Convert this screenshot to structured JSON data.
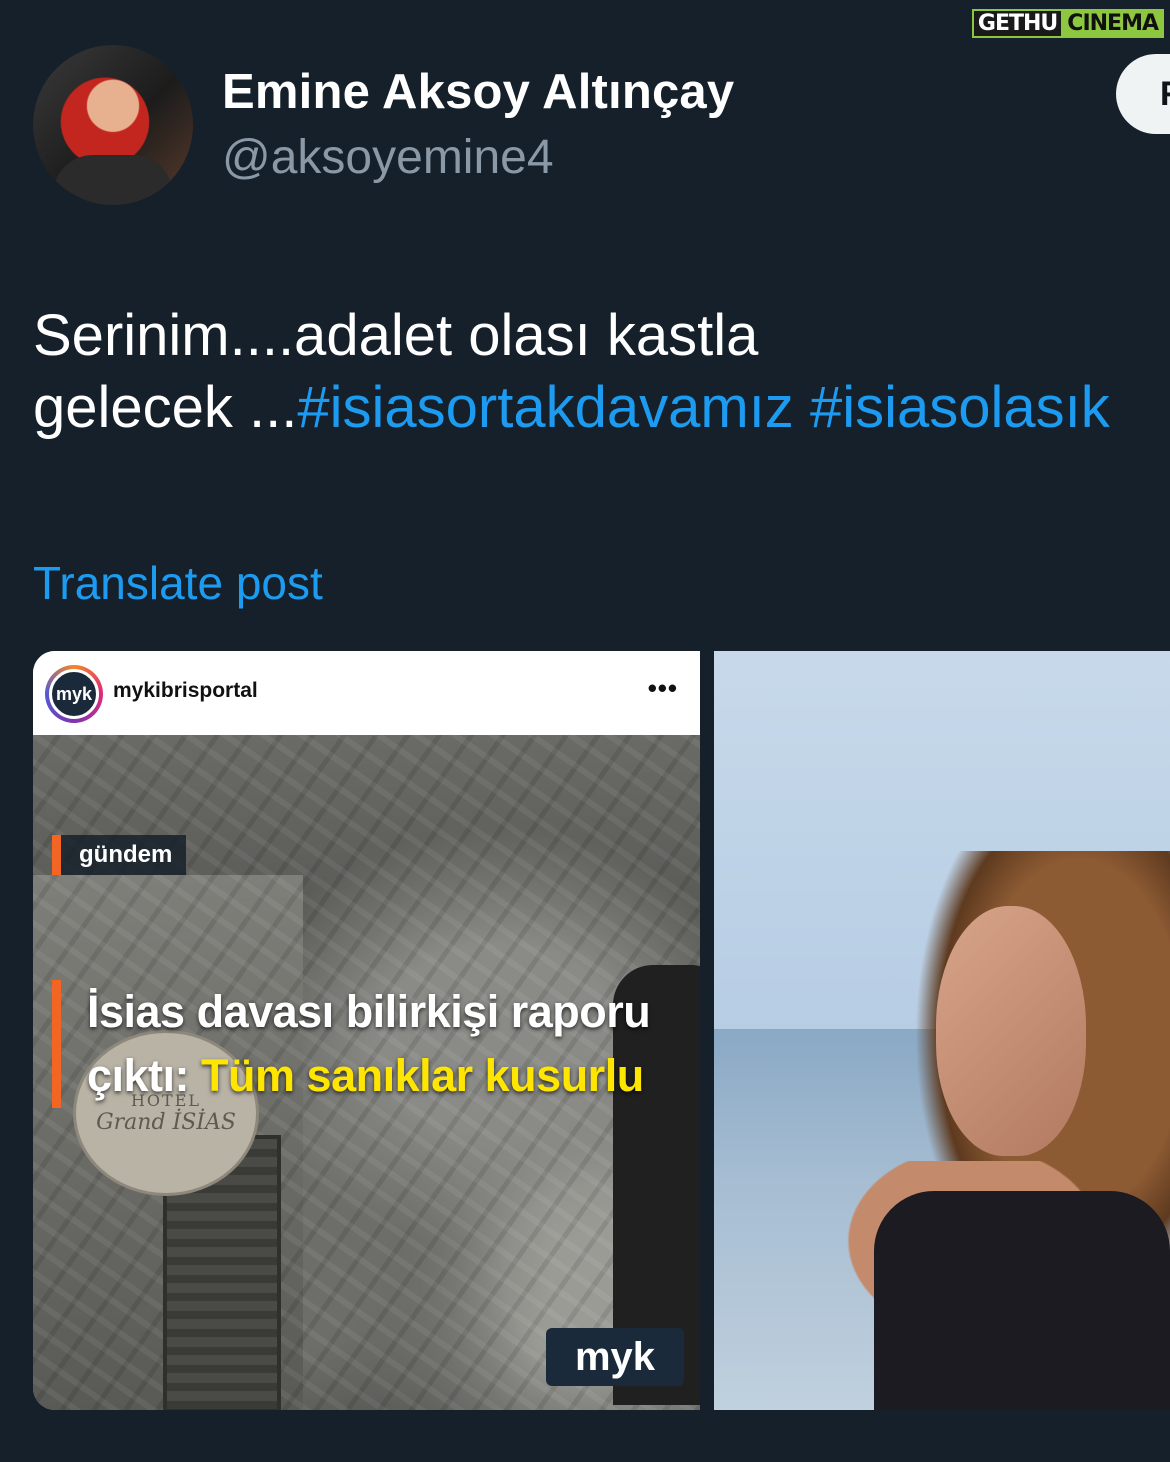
{
  "watermark": {
    "part1": "GETHU",
    "part2": "CINEMA"
  },
  "author": {
    "name": "Emine Aksoy Altınçay",
    "handle": "@aksoyemine4"
  },
  "follow_button": {
    "label": "F"
  },
  "tweet": {
    "text_line1": "Serinim....adalet olası kastla",
    "text_line2_prefix": "gelecek ...",
    "hashtag1": "#isiasortakdavamız",
    "hashtag2": "#isiasolasık"
  },
  "translate_link": "Translate post",
  "media": {
    "left": {
      "account": "mykibrisportal",
      "avatar_text": "myk",
      "menu": "•••",
      "category": "gündem",
      "headline_line1": "İsias davası bilirkişi raporu",
      "headline_line2_prefix": "çıktı: ",
      "headline_line2_highlight": "Tüm sanıklar kusurlu",
      "hotel_line1": "HOTEL",
      "hotel_line2": "Grand İSİAS",
      "logo": "myk"
    }
  },
  "colors": {
    "background": "#15202b",
    "accent": "#1d9bf0",
    "muted": "#8b98a5",
    "headline_accent": "#f26522",
    "highlight": "#ffe600"
  }
}
